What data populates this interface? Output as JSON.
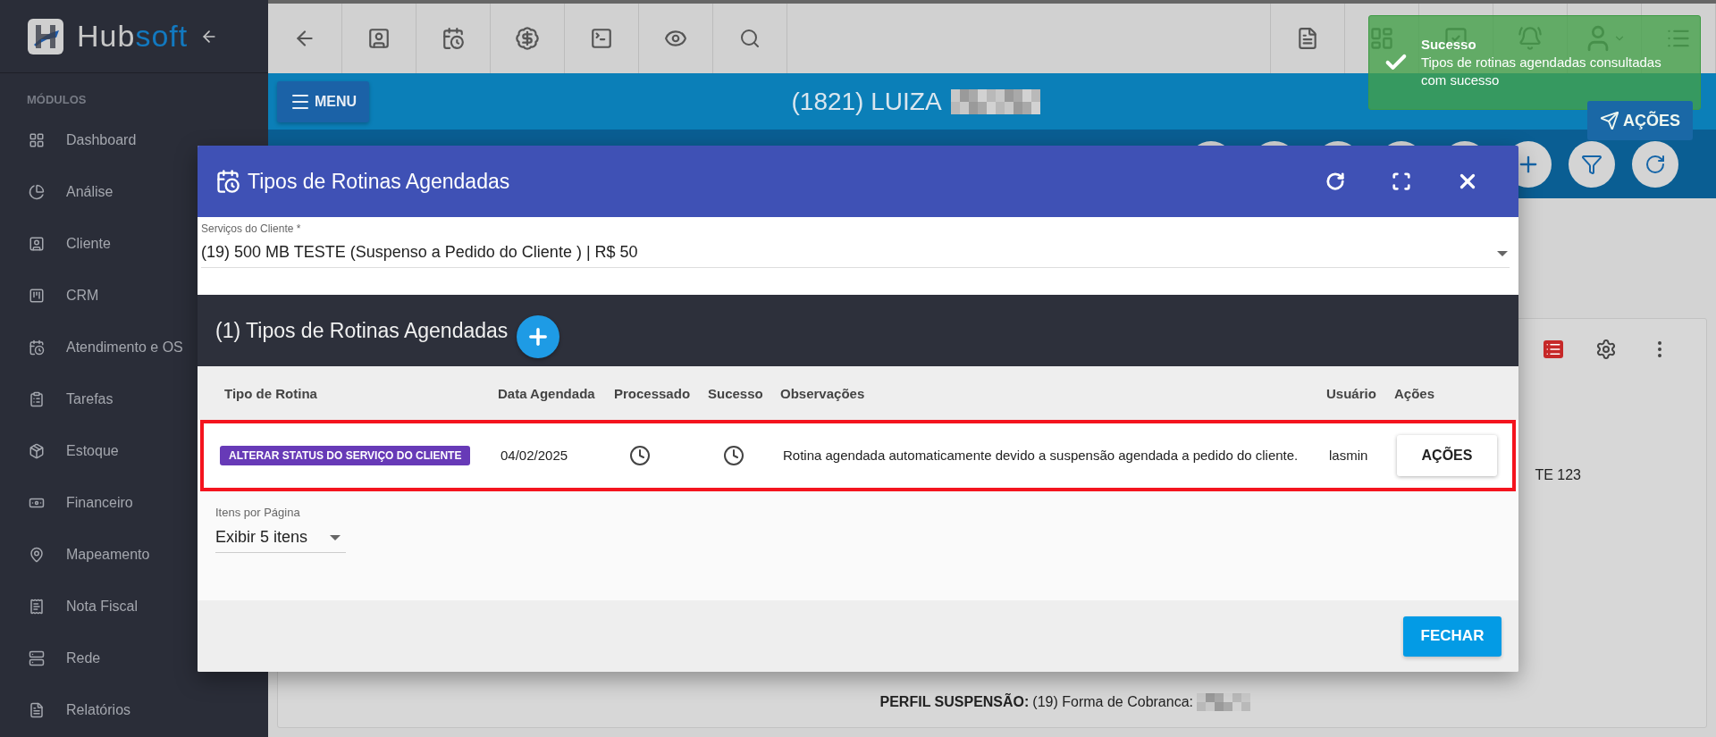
{
  "sidebar": {
    "brand_1": "Hub",
    "brand_2": "soft",
    "section_label": "MÓDULOS",
    "items": [
      {
        "label": "Dashboard"
      },
      {
        "label": "Análise"
      },
      {
        "label": "Cliente"
      },
      {
        "label": "CRM"
      },
      {
        "label": "Atendimento e OS"
      },
      {
        "label": "Tarefas"
      },
      {
        "label": "Estoque"
      },
      {
        "label": "Financeiro"
      },
      {
        "label": "Mapeamento"
      },
      {
        "label": "Nota Fiscal"
      },
      {
        "label": "Rede"
      },
      {
        "label": "Relatórios"
      }
    ]
  },
  "header": {
    "menu_label": "MENU",
    "client_title": "(1821) LUIZA",
    "actions_label": "AÇÕES"
  },
  "background_card": {
    "line_tail": "TE 123",
    "profile_label": "PERFIL SUSPENSÃO:",
    "profile_text": "(19) Forma de Cobranca:"
  },
  "modal": {
    "title": "Tipos de Rotinas Agendadas",
    "service_field": {
      "label": "Serviços do Cliente *",
      "value": "(19) 500 MB TESTE (Suspenso a Pedido do Cliente ) | R$ 50"
    },
    "section_title": "(1) Tipos de Rotinas Agendadas",
    "columns": [
      "Tipo de Rotina",
      "Data Agendada",
      "Processado",
      "Sucesso",
      "Observações",
      "Usuário",
      "Ações"
    ],
    "rows": [
      {
        "type": "ALTERAR STATUS DO SERVIÇO DO CLIENTE",
        "date": "04/02/2025",
        "processed": false,
        "success": false,
        "observation": "Rotina agendada automaticamente devido a suspensão agendada a pedido do cliente.",
        "user": "lasmin",
        "action": "AÇÕES",
        "highlighted": true
      }
    ],
    "pagination": {
      "label": "Itens por Página",
      "value": "Exibir 5 itens"
    },
    "close_label": "FECHAR"
  },
  "toast": {
    "title": "Sucesso",
    "message": "Tipos de rotinas agendadas consultadas com sucesso"
  }
}
